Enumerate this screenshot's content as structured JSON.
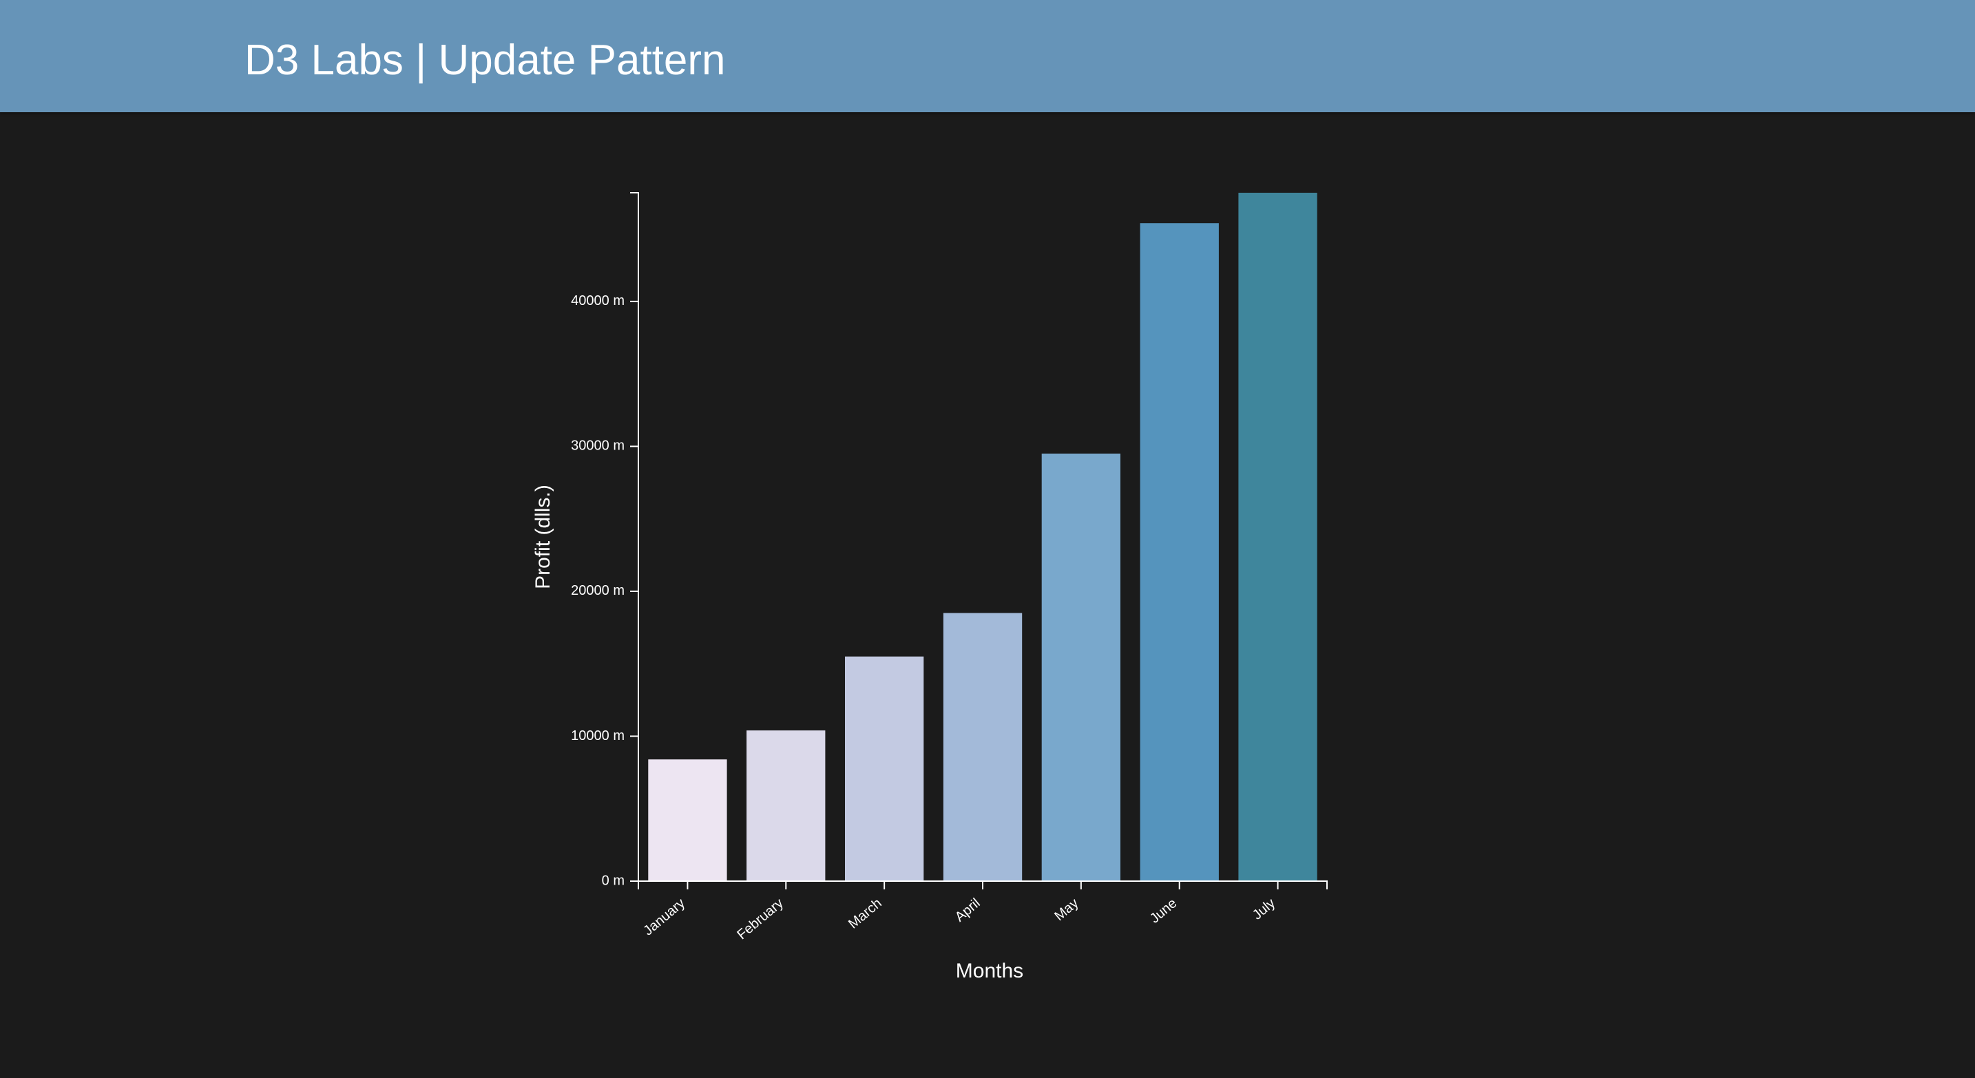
{
  "header": {
    "title": "D3 Labs | Update Pattern"
  },
  "colors": {
    "header_bg": "#6694b8",
    "page_bg": "#1b1b1b",
    "axis": "#ffffff",
    "bars": [
      "#ede5f2",
      "#dbd9ea",
      "#c3cae2",
      "#a3bad9",
      "#79a8cc",
      "#5594bd",
      "#3f869c"
    ]
  },
  "chart_data": {
    "type": "bar",
    "categories": [
      "January",
      "February",
      "March",
      "April",
      "May",
      "June",
      "July"
    ],
    "values": [
      8400,
      10400,
      15500,
      18500,
      29500,
      45400,
      47500
    ],
    "xlabel": "Months",
    "ylabel": "Profit (dlls.)",
    "ylim": [
      0,
      47500
    ],
    "yticks": [
      0,
      10000,
      20000,
      30000,
      40000
    ],
    "ytick_labels": [
      "0 m",
      "10000 m",
      "20000 m",
      "30000 m",
      "40000 m"
    ],
    "grid": false,
    "legend": "none"
  }
}
